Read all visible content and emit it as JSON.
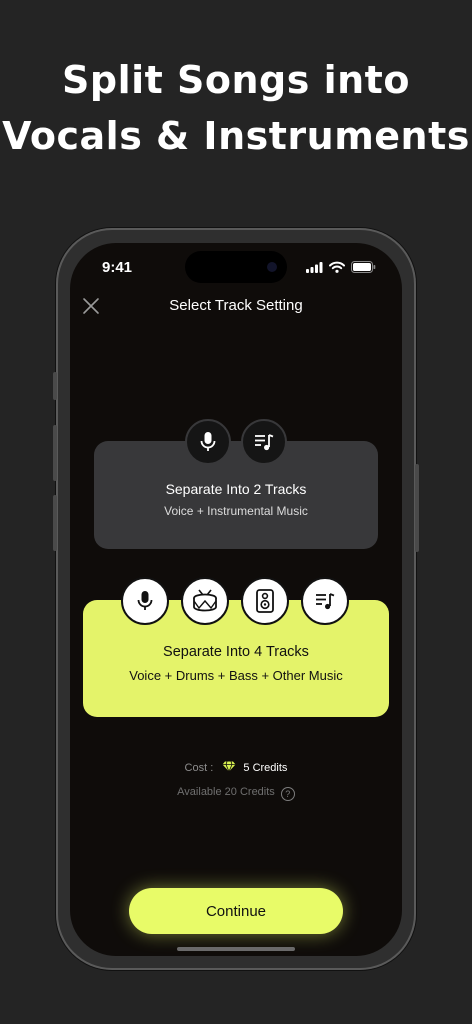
{
  "headline": {
    "line1": "Split Songs into",
    "line2": "Vocals & Instruments"
  },
  "status_bar": {
    "time": "9:41"
  },
  "nav": {
    "title": "Select Track Setting",
    "close_icon": "close-icon"
  },
  "option_two_tracks": {
    "title": "Separate Into 2 Tracks",
    "subtitle": "Voice + Instrumental Music",
    "icons": [
      "microphone-icon",
      "music-list-icon"
    ]
  },
  "option_four_tracks": {
    "title": "Separate Into 4 Tracks",
    "subtitle": "Voice + Drums + Bass + Other Music",
    "icons": [
      "microphone-icon",
      "drum-icon",
      "speaker-icon",
      "music-list-icon"
    ]
  },
  "cost": {
    "label": "Cost :",
    "value": "5 Credits",
    "icon": "diamond-icon"
  },
  "available": {
    "text": "Available 20 Credits"
  },
  "continue": {
    "label": "Continue"
  },
  "colors": {
    "accent": "#E8FB68",
    "card_dark": "#38383A",
    "background": "#242424"
  }
}
